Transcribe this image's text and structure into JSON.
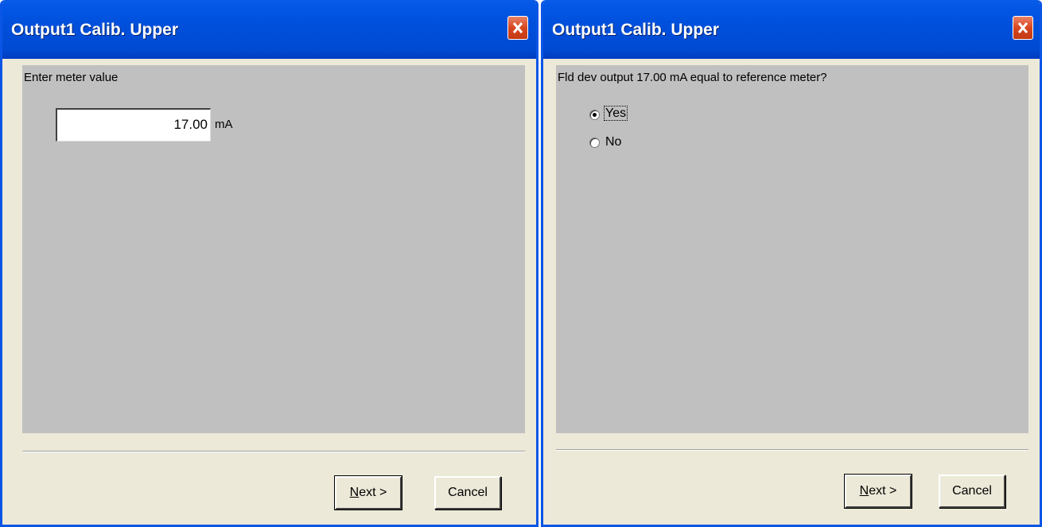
{
  "left_dialog": {
    "title": "Output1 Calib. Upper",
    "prompt": "Enter meter value",
    "meter_value": "17.00",
    "unit": "mA",
    "next_prefix": "N",
    "next_rest": "ext >",
    "cancel_label": "Cancel"
  },
  "right_dialog": {
    "title": "Output1 Calib. Upper",
    "question": "Fld dev output 17.00 mA equal to reference meter?",
    "options": [
      {
        "label": "Yes",
        "selected": true
      },
      {
        "label": "No",
        "selected": false
      }
    ],
    "next_prefix": "N",
    "next_rest": "ext >",
    "cancel_label": "Cancel"
  },
  "icons": {
    "close": "close-icon"
  },
  "colors": {
    "titlebar": "#0050dc",
    "close_button": "#d8461f",
    "window_bg": "#ece9d8",
    "panel_bg": "#c0c0c0"
  }
}
